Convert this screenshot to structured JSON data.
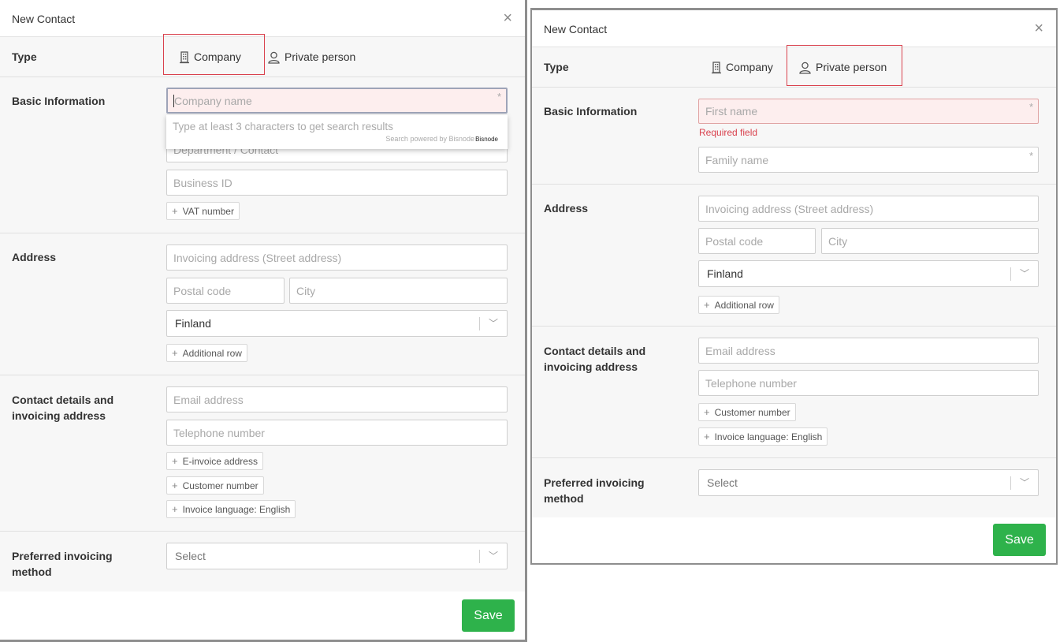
{
  "dialog_left": {
    "title": "New Contact",
    "close_glyph": "×",
    "type_label": "Type",
    "type_company": "Company",
    "type_private": "Private person",
    "basic_label": "Basic Information",
    "company_name_ph": "Company name",
    "department_ph": "Department / Contact",
    "business_id_ph": "Business ID",
    "vat_btn": "VAT number",
    "search_hint": "Type at least 3 characters to get search results",
    "search_powered": "Search powered by Bisnode",
    "search_logo": "Bisnode",
    "address_label": "Address",
    "street_ph": "Invoicing address (Street address)",
    "postal_ph": "Postal code",
    "city_ph": "City",
    "country_value": "Finland",
    "additional_row_btn": "Additional row",
    "contact_label_1": "Contact details and",
    "contact_label_2": "invoicing address",
    "email_ph": "Email address",
    "phone_ph": "Telephone number",
    "einvoice_btn": "E-invoice address",
    "customer_number_btn": "Customer number",
    "invoice_language_btn": "Invoice language: English",
    "pref_label_1": "Preferred invoicing",
    "pref_label_2": "method",
    "select_ph": "Select",
    "save": "Save"
  },
  "dialog_right": {
    "title": "New Contact",
    "close_glyph": "×",
    "type_label": "Type",
    "type_company": "Company",
    "type_private": "Private person",
    "basic_label": "Basic Information",
    "first_name_ph": "First name",
    "required_text": "Required field",
    "family_name_ph": "Family name",
    "address_label": "Address",
    "street_ph": "Invoicing address (Street address)",
    "postal_ph": "Postal code",
    "city_ph": "City",
    "country_value": "Finland",
    "additional_row_btn": "Additional row",
    "contact_label_1": "Contact details and",
    "contact_label_2": "invoicing address",
    "email_ph": "Email address",
    "phone_ph": "Telephone number",
    "customer_number_btn": "Customer number",
    "invoice_language_btn": "Invoice language: English",
    "pref_label_1": "Preferred invoicing",
    "pref_label_2": "method",
    "select_ph": "Select",
    "save": "Save"
  },
  "glyphs": {
    "required_mark": "*",
    "plus": "+",
    "chevron": "﹀"
  },
  "colors": {
    "accent_save": "#2eb24b",
    "error": "#d9414d",
    "highlight_box": "#d9414d"
  }
}
